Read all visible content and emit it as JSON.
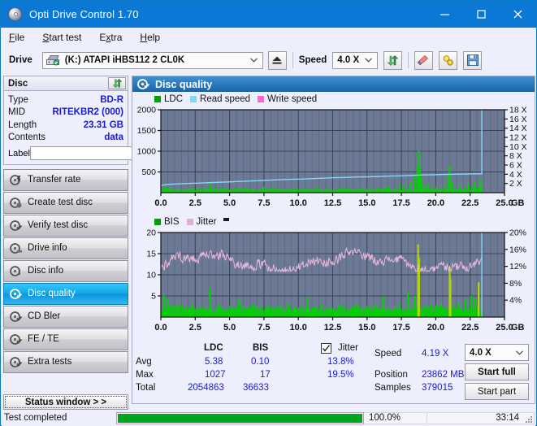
{
  "window": {
    "title": "Opti Drive Control 1.70",
    "icon": "disc-icon",
    "minimize": "–",
    "maximize": "□",
    "close": "✕"
  },
  "menu": [
    {
      "label": "File",
      "accel": "F"
    },
    {
      "label": "Start test",
      "accel": "S"
    },
    {
      "label": "Extra",
      "accel": "x"
    },
    {
      "label": "Help",
      "accel": "H"
    }
  ],
  "toolbar": {
    "drive_label": "Drive",
    "drive_value": "(K:)   ATAPI iHBS112   2 CL0K",
    "eject_icon": "eject-icon",
    "speed_label": "Speed",
    "speed_value": "4.0 X",
    "refresh_icon": "refresh-icon",
    "eraser_icon": "eraser-icon",
    "tools_icon": "tools-icon",
    "save_icon": "save-icon"
  },
  "disc_panel": {
    "title": "Disc",
    "refresh_icon": "refresh-icon",
    "rows": [
      {
        "key": "Type",
        "value": "BD-R"
      },
      {
        "key": "MID",
        "value": "RITEKBR2 (000)"
      },
      {
        "key": "Length",
        "value": "23.31 GB"
      },
      {
        "key": "Contents",
        "value": "data"
      }
    ],
    "label_key": "Label",
    "label_value": "",
    "label_placeholder": "",
    "label_button_icon": "disc-icon"
  },
  "nav": {
    "items": [
      {
        "label": "Transfer rate",
        "icon": "disc-transfer-icon",
        "active": false
      },
      {
        "label": "Create test disc",
        "icon": "disc-create-icon",
        "active": false
      },
      {
        "label": "Verify test disc",
        "icon": "disc-verify-icon",
        "active": false
      },
      {
        "label": "Drive info",
        "icon": "disc-drive-icon",
        "active": false
      },
      {
        "label": "Disc info",
        "icon": "disc-info-icon",
        "active": false
      },
      {
        "label": "Disc quality",
        "icon": "disc-quality-icon",
        "active": true
      },
      {
        "label": "CD Bler",
        "icon": "disc-bler-icon",
        "active": false
      },
      {
        "label": "FE / TE",
        "icon": "disc-fete-icon",
        "active": false
      },
      {
        "label": "Extra tests",
        "icon": "disc-extra-icon",
        "active": false
      }
    ],
    "status_window_button": "Status window > >"
  },
  "content": {
    "title": "Disc quality",
    "title_icon": "disc-quality-icon"
  },
  "chart_data": [
    {
      "type": "line",
      "name": "top",
      "title": "",
      "xlabel": "GB",
      "ylabel": "",
      "xlim": [
        0,
        25
      ],
      "ylim": [
        0,
        2000
      ],
      "y2lim": [
        0,
        18
      ],
      "xticks": [
        "0.0",
        "2.5",
        "5.0",
        "7.5",
        "10.0",
        "12.5",
        "15.0",
        "17.5",
        "20.0",
        "22.5",
        "25.0"
      ],
      "yticks": [
        "2000",
        "1500",
        "1000",
        "500"
      ],
      "y2ticks": [
        "18 X",
        "16 X",
        "14 X",
        "12 X",
        "10 X",
        "8 X",
        "6 X",
        "4 X",
        "2 X"
      ],
      "grid": true,
      "legend_position": "top-left",
      "legend": [
        {
          "label": "LDC",
          "color": "#00a000"
        },
        {
          "label": "Read speed",
          "color": "#84d7f5"
        },
        {
          "label": "Write speed",
          "color": "#ff66d5"
        }
      ],
      "series": [
        {
          "name": "Read speed",
          "color": "#84d7f5",
          "axis": "right",
          "x": [
            0.0,
            0.6,
            1.2,
            2.0,
            3.0,
            3.8,
            4.6,
            5.4,
            6.2,
            7.0,
            7.8,
            8.6,
            9.4,
            10.2,
            11.0,
            11.8,
            12.6,
            13.4,
            14.2,
            15.0,
            15.8,
            16.6,
            17.4,
            18.2,
            19.0,
            19.8,
            20.6,
            21.4,
            22.2,
            23.0,
            23.35,
            23.35
          ],
          "y": [
            1.6,
            1.8,
            1.9,
            2.0,
            2.1,
            2.2,
            2.3,
            2.4,
            2.5,
            2.6,
            2.7,
            2.8,
            2.9,
            2.95,
            3.05,
            3.15,
            3.25,
            3.3,
            3.4,
            3.45,
            3.5,
            3.6,
            3.65,
            3.75,
            3.85,
            3.9,
            3.95,
            4.0,
            4.05,
            4.1,
            4.1,
            18.0
          ]
        },
        {
          "name": "LDC",
          "color": "#00d200",
          "axis": "left",
          "x": [
            0.1,
            0.2,
            0.35,
            0.5,
            0.7,
            0.9,
            1.1,
            1.35,
            1.6,
            1.85,
            2.1,
            2.35,
            2.6,
            2.85,
            3.1,
            3.35,
            3.5,
            3.6,
            3.75,
            4.0,
            4.25,
            4.5,
            4.75,
            5.0,
            5.3,
            5.6,
            5.9,
            6.2,
            6.5,
            6.8,
            7.1,
            7.4,
            7.7,
            8.0,
            8.3,
            8.6,
            8.9,
            9.2,
            9.5,
            9.8,
            10.1,
            10.4,
            10.7,
            11.0,
            11.3,
            11.6,
            11.9,
            12.2,
            12.5,
            12.8,
            13.1,
            13.4,
            13.7,
            14.0,
            14.3,
            14.6,
            14.9,
            15.2,
            15.5,
            15.8,
            16.1,
            16.4,
            16.7,
            17.0,
            17.3,
            17.55,
            17.6,
            17.8,
            18.1,
            18.4,
            18.6,
            18.7,
            18.8,
            18.9,
            19.1,
            19.4,
            19.7,
            20.0,
            20.3,
            20.6,
            20.85,
            20.95,
            21.1,
            21.4,
            21.7,
            22.0,
            22.3,
            22.55,
            22.8,
            23.05,
            23.2,
            23.3
          ],
          "y": [
            120,
            70,
            150,
            60,
            90,
            50,
            70,
            45,
            80,
            50,
            65,
            45,
            90,
            55,
            120,
            80,
            270,
            110,
            60,
            90,
            70,
            110,
            60,
            95,
            70,
            130,
            60,
            90,
            55,
            80,
            60,
            150,
            70,
            55,
            95,
            60,
            80,
            55,
            110,
            65,
            75,
            60,
            95,
            55,
            140,
            70,
            60,
            90,
            55,
            70,
            60,
            95,
            55,
            75,
            60,
            90,
            55,
            70,
            60,
            110,
            55,
            170,
            75,
            60,
            230,
            90,
            170,
            80,
            260,
            420,
            620,
            1020,
            620,
            380,
            170,
            220,
            110,
            150,
            90,
            200,
            420,
            660,
            260,
            120,
            170,
            90,
            220,
            130,
            260,
            120,
            330,
            110
          ]
        }
      ]
    },
    {
      "type": "line",
      "name": "bottom",
      "title": "",
      "xlabel": "GB",
      "ylabel": "",
      "xlim": [
        0,
        25
      ],
      "ylim": [
        0,
        20
      ],
      "y2lim": [
        0,
        20
      ],
      "xticks": [
        "0.0",
        "2.5",
        "5.0",
        "7.5",
        "10.0",
        "12.5",
        "15.0",
        "17.5",
        "20.0",
        "22.5",
        "25.0"
      ],
      "yticks": [
        "20",
        "15",
        "10",
        "5"
      ],
      "y2ticks": [
        "20%",
        "16%",
        "12%",
        "8%",
        "4%"
      ],
      "grid": true,
      "legend_position": "top-left",
      "legend": [
        {
          "label": "BIS",
          "color": "#00a000"
        },
        {
          "label": "Jitter",
          "color": "#e0aed6"
        }
      ],
      "series": [
        {
          "name": "Jitter",
          "color": "#e8b8dd",
          "axis": "right",
          "values_note": "noisy band centered ~13.8%, min ~11%, max ~19.5%"
        },
        {
          "name": "BIS",
          "color": "#00d200",
          "axis": "left",
          "values_note": "dense baseline ~2, spikes up to 17 at 18.7 and 21.0 GB"
        }
      ]
    }
  ],
  "stats": {
    "headers": {
      "ldc": "LDC",
      "bis": "BIS",
      "jitter": "Jitter"
    },
    "jitter_checked": true,
    "rows": [
      {
        "label": "Avg",
        "ldc": "5.38",
        "bis": "0.10",
        "jitter": "13.8%"
      },
      {
        "label": "Max",
        "ldc": "1027",
        "bis": "17",
        "jitter": "19.5%"
      },
      {
        "label": "Total",
        "ldc": "2054863",
        "bis": "36633",
        "jitter": ""
      }
    ],
    "speed_label": "Speed",
    "speed_value": "4.19 X",
    "position_label": "Position",
    "position_value": "23862 MB",
    "samples_label": "Samples",
    "samples_value": "379015",
    "speed_select": "4.0 X",
    "start_full": "Start full",
    "start_part": "Start part"
  },
  "statusbar": {
    "message": "Test completed",
    "progress_percent": "100.0%",
    "progress_value": 100,
    "elapsed": "33:14"
  },
  "colors": {
    "title_bar": "#0a78d4",
    "accent": "#1a1ad6",
    "plot_bg": "#6d7a96",
    "green": "#00d200",
    "read_speed": "#84d7f5",
    "jitter": "#e8b8dd",
    "progress": "#00a61e"
  }
}
